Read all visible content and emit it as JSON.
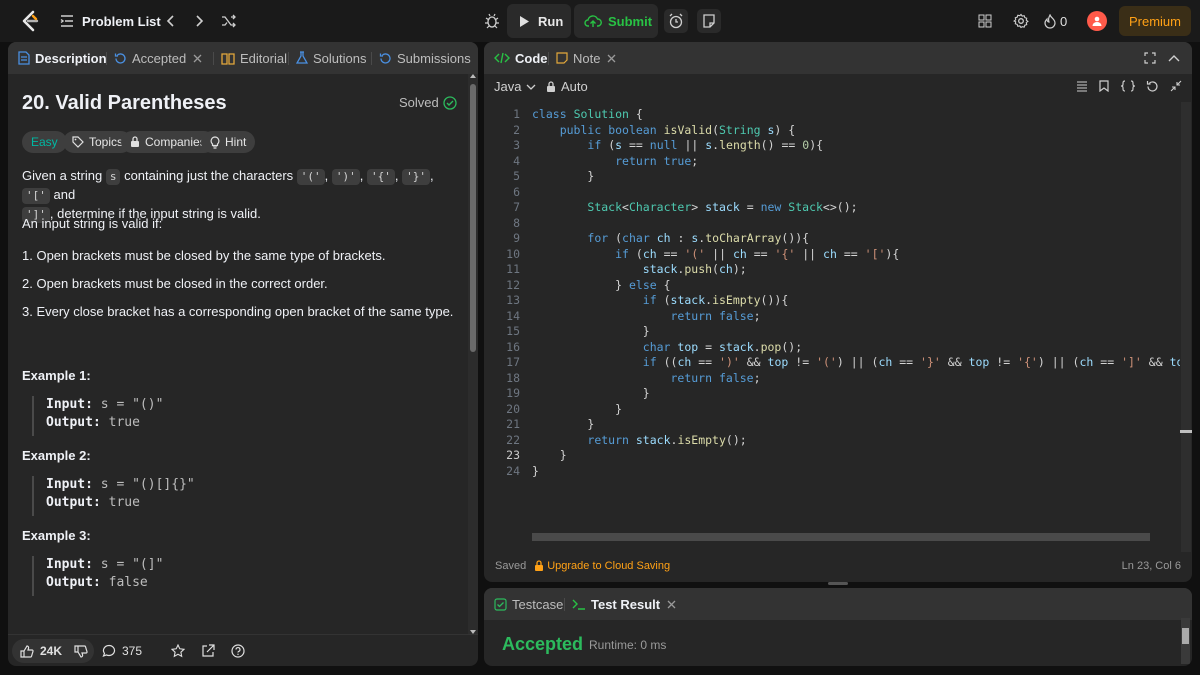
{
  "topbar": {
    "problem_list": "Problem List",
    "run": "Run",
    "submit": "Submit",
    "streak": "0",
    "premium": "Premium"
  },
  "left": {
    "tabs": [
      {
        "label": "Description"
      },
      {
        "label": "Accepted"
      },
      {
        "label": "Editorial"
      },
      {
        "label": "Solutions"
      },
      {
        "label": "Submissions"
      }
    ],
    "title": "20. Valid Parentheses",
    "solved": "Solved",
    "tags": [
      "Easy",
      "Topics",
      "Companies",
      "Hint"
    ],
    "p1_a": "Given a string ",
    "p1_s": "s",
    "p1_b": " containing just the characters ",
    "chars": [
      "'('",
      "')'",
      "'{'",
      "'}'",
      "'['"
    ],
    "p1_and": " and",
    "char_last": "']'",
    "p1_end": ", determine if the input string is valid.",
    "p2": "An input string is valid if:",
    "rules": [
      "1. Open brackets must be closed by the same type of brackets.",
      "2. Open brackets must be closed in the correct order.",
      "3. Every close bracket has a corresponding open bracket of the same type."
    ],
    "examples": [
      {
        "title": "Example 1:",
        "input_label": "Input:",
        "input": "s = \"()\"",
        "output_label": "Output:",
        "output": "true"
      },
      {
        "title": "Example 2:",
        "input_label": "Input:",
        "input": "s = \"()[]{}\"",
        "output_label": "Output:",
        "output": "true"
      },
      {
        "title": "Example 3:",
        "input_label": "Input:",
        "input": "s = \"(]\"",
        "output_label": "Output:",
        "output": "false"
      }
    ],
    "likes": "24K",
    "comments": "375"
  },
  "code": {
    "tab": "Code",
    "note": "Note",
    "language": "Java",
    "mode": "Auto",
    "lines": [
      "class Solution {",
      "    public boolean isValid(String s) {",
      "        if (s == null || s.length() == 0){",
      "            return true;",
      "        }",
      "",
      "        Stack<Character> stack = new Stack<>();",
      "",
      "        for (char ch : s.toCharArray()){",
      "            if (ch == '(' || ch == '{' || ch == '['){",
      "                stack.push(ch);",
      "            } else {",
      "                if (stack.isEmpty()){",
      "                    return false;",
      "                }",
      "                char top = stack.pop();",
      "                if ((ch == ')' && top != '(') || (ch == '}' && top != '{') || (ch == ']' && top != '[')) {",
      "                    return false;",
      "                }",
      "            }",
      "        }",
      "        return stack.isEmpty();",
      "    }",
      "}"
    ],
    "saved": "Saved",
    "upgrade": "Upgrade to Cloud Saving",
    "cursor": "Ln 23, Col 6"
  },
  "result": {
    "testcase": "Testcase",
    "test_result": "Test Result",
    "status": "Accepted",
    "runtime": "Runtime: 0 ms"
  },
  "colors": {
    "accepted": "#2cbb5d",
    "premium": "#ffa116",
    "easy": "#00b8a3",
    "submit": "#28c244"
  }
}
